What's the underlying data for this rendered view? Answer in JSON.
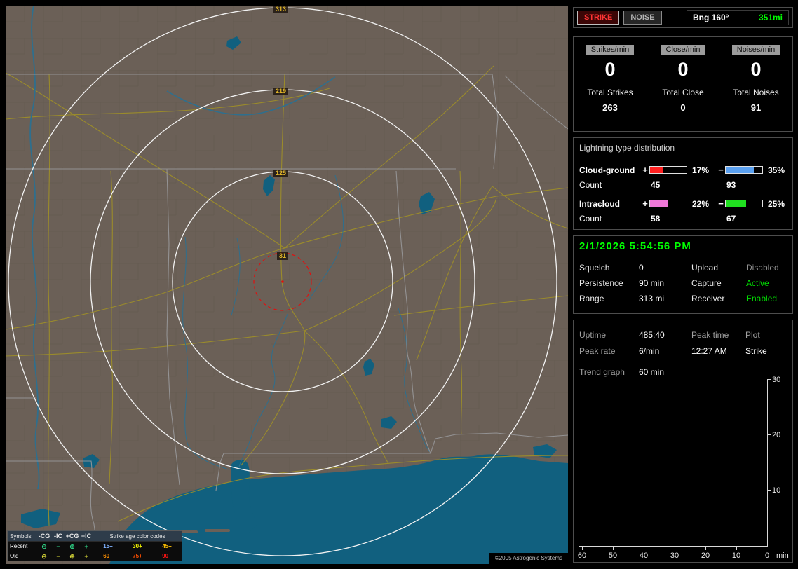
{
  "colors": {
    "accent_green": "#00ff00",
    "status_green": "#00dd00",
    "status_gray": "#909090"
  },
  "map": {
    "ring_labels": [
      "313",
      "219",
      "125",
      "31"
    ],
    "legend": {
      "symbols_label": "Symbols",
      "col_headers": [
        "-CG",
        "-IC",
        "+CG",
        "+IC"
      ],
      "age_title": "Strike age color codes",
      "symbols": [
        "⊖",
        "−",
        "⊕",
        "+"
      ],
      "rows": [
        {
          "label": "Recent",
          "symbol_color": "#2fd487",
          "ages": [
            {
              "t": "15+",
              "c": "#7fb2ff"
            },
            {
              "t": "30+",
              "c": "#f0f000"
            },
            {
              "t": "45+",
              "c": "#ffc000"
            }
          ]
        },
        {
          "label": "Old",
          "symbol_color": "#d8d838",
          "ages": [
            {
              "t": "60+",
              "c": "#ff9000"
            },
            {
              "t": "75+",
              "c": "#ff5000"
            },
            {
              "t": "90+",
              "c": "#ff1414"
            }
          ]
        }
      ]
    },
    "copyright": "©2005 Astrogenic Systems"
  },
  "panel": {
    "strike_button": "STRIKE",
    "noise_button": "NOISE",
    "bearing": {
      "label": "Bng 160°",
      "distance": "351mi"
    },
    "counters": [
      {
        "rate_label": "Strikes/min",
        "rate": "0",
        "total_label": "Total Strikes",
        "total": "263"
      },
      {
        "rate_label": "Close/min",
        "rate": "0",
        "total_label": "Total Close",
        "total": "0"
      },
      {
        "rate_label": "Noises/min",
        "rate": "0",
        "total_label": "Total Noises",
        "total": "91"
      }
    ],
    "distribution": {
      "title": "Lightning type distribution",
      "count_label": "Count",
      "rows": [
        {
          "name": "Cloud-ground",
          "plus": "+",
          "minus": "−",
          "pos_pct": "17%",
          "neg_pct": "35%",
          "pos_count": "45",
          "neg_count": "93",
          "pos_color": "#ff2020",
          "neg_color": "#5aa0f0",
          "pos_fill": "37%",
          "neg_fill": "77%"
        },
        {
          "name": "Intracloud",
          "plus": "+",
          "minus": "−",
          "pos_pct": "22%",
          "neg_pct": "25%",
          "pos_count": "58",
          "neg_count": "67",
          "pos_color": "#f078d8",
          "neg_color": "#20e020",
          "pos_fill": "48%",
          "neg_fill": "55%"
        }
      ]
    },
    "datetime": "2/1/2026 5:54:56 PM",
    "settings": [
      {
        "label": "Squelch",
        "value": "0"
      },
      {
        "label": "Persistence",
        "value": "90 min"
      },
      {
        "label": "Range",
        "value": "313 mi"
      },
      {
        "label": "Upload",
        "value": "Disabled",
        "state_color": "#909090"
      },
      {
        "label": "Capture",
        "value": "Active",
        "state_color": "#00dd00"
      },
      {
        "label": "Receiver",
        "value": "Enabled",
        "state_color": "#00dd00"
      }
    ],
    "status": {
      "uptime_label": "Uptime",
      "uptime": "485:40",
      "peak_time_label": "Peak time",
      "plot_label": "Plot",
      "peak_rate_label": "Peak rate",
      "peak_rate": "6/min",
      "peak_time": "12:27 AM",
      "plot_value": "Strike",
      "trend_label": "Trend graph",
      "trend_value": "60 min"
    },
    "trend": {
      "x_ticks": [
        "60",
        "50",
        "40",
        "30",
        "20",
        "10"
      ],
      "y_ticks": [
        "30",
        "20",
        "10"
      ],
      "origin": "0",
      "unit": "min"
    }
  }
}
